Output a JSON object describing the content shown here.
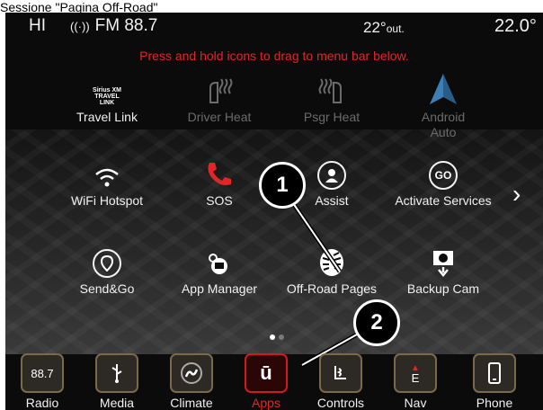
{
  "caption": "Sessione \"Pagina Off-Road\"",
  "status": {
    "driver_mode": "HI",
    "radio": "FM 88.7",
    "outside_temp": "22°",
    "outside_suffix": "out.",
    "set_temp": "22.0°"
  },
  "hint": "Press and hold icons to drag to menu bar below.",
  "sxm_badge": [
    "Sirius XM",
    "TRAVEL",
    "LINK"
  ],
  "apps_row1": [
    {
      "label": "Travel Link",
      "icon": "siriusxm-travel-link-icon",
      "enabled": true
    },
    {
      "label": "Driver Heat",
      "icon": "driver-heat-icon",
      "enabled": false
    },
    {
      "label": "Psgr Heat",
      "icon": "passenger-heat-icon",
      "enabled": false
    },
    {
      "label": "Android\nAuto",
      "icon": "android-auto-icon",
      "enabled": false
    }
  ],
  "apps_row2": [
    {
      "label": "WiFi Hotspot",
      "icon": "wifi-icon"
    },
    {
      "label": "SOS",
      "icon": "phone-sos-icon"
    },
    {
      "label": "Assist",
      "icon": "assist-icon"
    },
    {
      "label": "Activate Services",
      "icon": "go-icon",
      "icon_text": "GO"
    }
  ],
  "apps_row3": [
    {
      "label": "Send&Go",
      "icon": "send-and-go-icon"
    },
    {
      "label": "App Manager",
      "icon": "app-manager-icon"
    },
    {
      "label": "Off-Road Pages",
      "icon": "off-road-tire-icon"
    },
    {
      "label": "Backup Cam",
      "icon": "backup-camera-icon"
    }
  ],
  "callouts": [
    "1",
    "2"
  ],
  "dock": [
    {
      "label": "Radio",
      "icon": "radio-icon",
      "icon_text": "88.7",
      "active": false
    },
    {
      "label": "Media",
      "icon": "usb-icon",
      "active": false
    },
    {
      "label": "Climate",
      "icon": "climate-icon",
      "active": false
    },
    {
      "label": "Apps",
      "icon": "apps-icon",
      "icon_text": "ū",
      "active": true
    },
    {
      "label": "Controls",
      "icon": "controls-icon",
      "active": false
    },
    {
      "label": "Nav",
      "icon": "nav-compass-icon",
      "icon_text": "E",
      "active": false
    },
    {
      "label": "Phone",
      "icon": "phone-icon",
      "active": false
    }
  ],
  "colors": {
    "accent_red": "#e22626",
    "screen_bg": "#0b0b0c",
    "dock_border": "#7a6a4a"
  }
}
